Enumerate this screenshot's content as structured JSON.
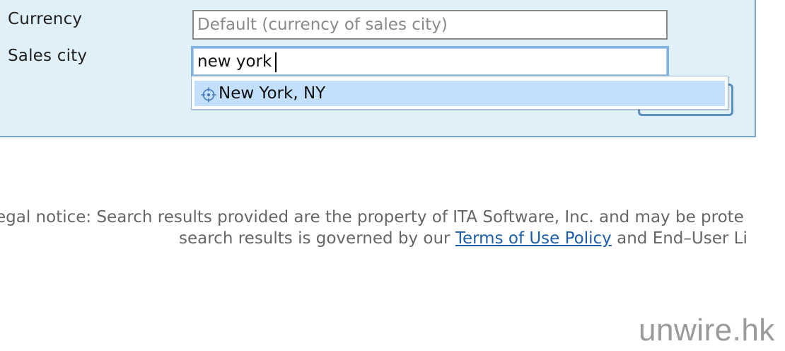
{
  "form": {
    "currency": {
      "label": "Currency",
      "placeholder": "Default (currency of sales city)",
      "value": ""
    },
    "sales_city": {
      "label": "Sales city",
      "value": "new york"
    },
    "autocomplete": {
      "items": [
        {
          "label": "New York, NY",
          "icon": "location-crosshair-icon"
        }
      ]
    }
  },
  "legal": {
    "line1": "egal notice: Search results provided are the property of ITA Software, Inc. and may be prote",
    "line2_prefix": "search results is governed by our ",
    "terms_link": "Terms of Use Policy",
    "line2_suffix": " and End–User Li"
  },
  "watermark": "unwire.hk",
  "colors": {
    "panel_bg": "#e0f0f8",
    "panel_border": "#7aa7c7",
    "focus_border": "#7fb3e3",
    "highlight": "#c2e0fb",
    "link": "#1d5ea8"
  }
}
